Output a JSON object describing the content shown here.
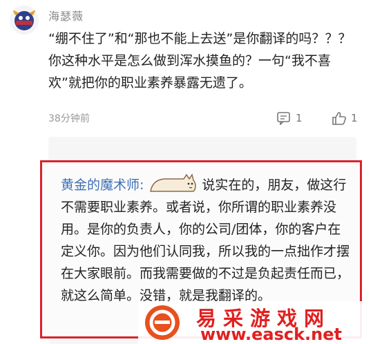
{
  "comment": {
    "username": "海瑟薇",
    "text": "“绷不住了”和“那也不能上去送”是你翻译的吗？？？你这种水平是怎么做到浑水摸鱼的？一句“我不喜欢”就把你的职业素养暴露无遗了。",
    "time": "38分钟前",
    "reply_count": "1",
    "like_count": "1",
    "avatar_icon": "cartoon-creature-avatar"
  },
  "reply": {
    "author": "黄金的魔术师:",
    "text": "说实在的，朋友，做这行不需要职业素养。或者说，你所谓的职业素养没用。是你的负责人，你的公司/团体，你的客户在定义你。因为他们认同我，所以我的一点拙作才摆在大家眼前。而我需要做的不过是负起责任而已，就这么简单。没错，就是我翻译的。",
    "sticker_icon": "cat-sticker"
  },
  "watermark": {
    "title": "易采游戏网",
    "url": "www.easck.net"
  },
  "colors": {
    "highlight": "#d9232a",
    "author_link": "#3e6fb5",
    "watermark": "#e0201f"
  }
}
